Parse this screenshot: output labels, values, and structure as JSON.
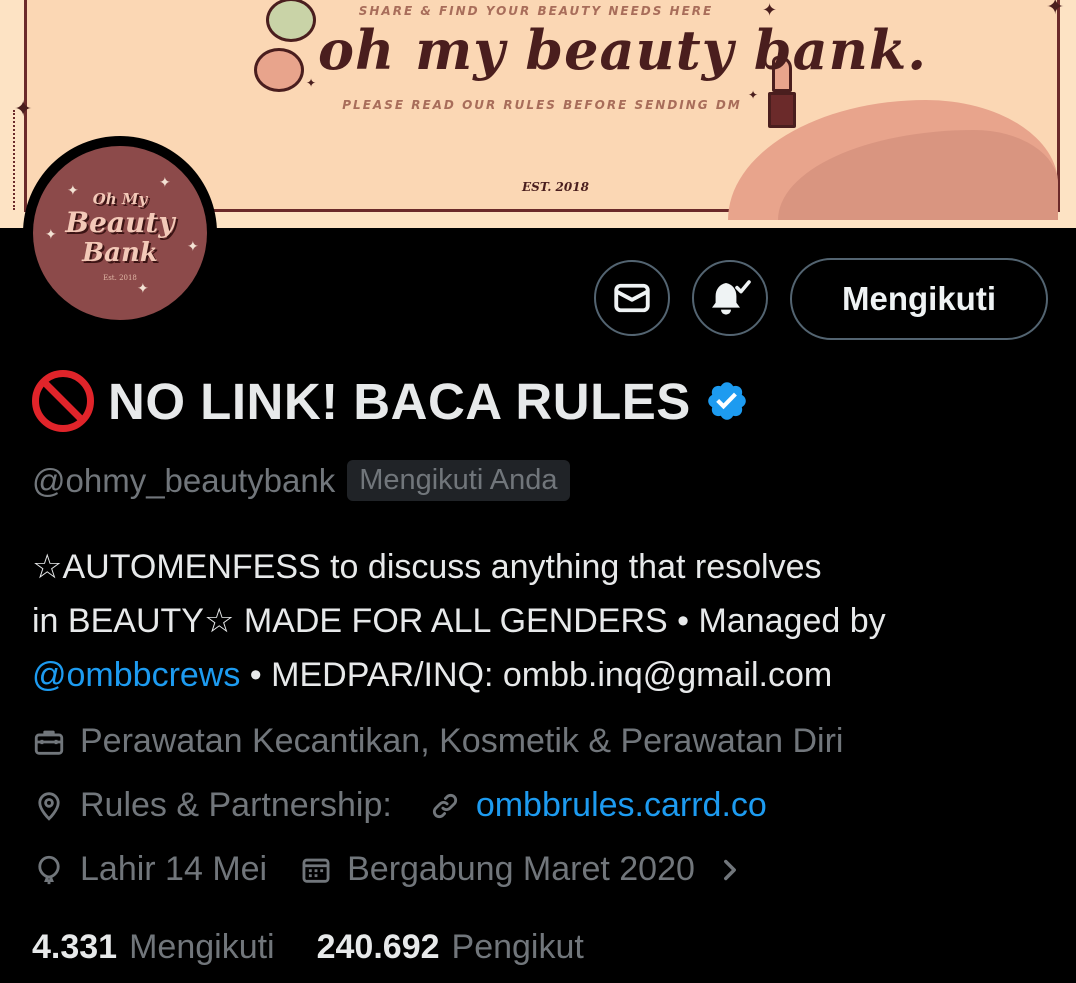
{
  "banner": {
    "tagline": "SHARE & FIND YOUR BEAUTY NEEDS HERE",
    "title": "oh my beauty bank.",
    "subtitle": "PLEASE READ OUR RULES BEFORE SENDING DM",
    "est": "EST. 2018",
    "colors": {
      "background": "#fbd7b4",
      "accent": "#4a1e1e",
      "wave": "#e8a48c"
    }
  },
  "avatar": {
    "line1": "Oh My",
    "line2": "Beauty",
    "line3": "Bank",
    "line4": "Est. 2018",
    "background": "#8c4a4a"
  },
  "actions": {
    "message_icon": "mail-icon",
    "notify_icon": "bell-check-icon",
    "follow_label": "Mengikuti"
  },
  "profile": {
    "name": "NO LINK! BACA RULES",
    "name_prefix_icon": "no-entry-icon",
    "verified_icon": "verified-badge-icon",
    "handle": "@ohmy_beautybank",
    "follows_you": "Mengikuti Anda"
  },
  "bio": {
    "line1": "☆AUTOMENFESS to discuss anything that resolves",
    "line2": "in BEAUTY☆ MADE FOR ALL GENDERS • Managed by",
    "mention": "@ombbcrews",
    "line3_rest": " • MEDPAR/INQ: ombb.inq@gmail.com"
  },
  "meta": {
    "category": "Perawatan Kecantikan, Kosmetik & Perawatan Diri",
    "location": "Rules & Partnership:",
    "link": "ombbrules.carrd.co",
    "birthday": "Lahir 14 Mei",
    "joined": "Bergabung Maret 2020",
    "icons": [
      "briefcase-icon",
      "location-pin-icon",
      "link-icon",
      "balloon-icon",
      "calendar-icon",
      "chevron-right-icon"
    ]
  },
  "stats": {
    "following_count": "4.331",
    "following_label": "Mengikuti",
    "followers_count": "240.692",
    "followers_label": "Pengikut"
  },
  "colors": {
    "link": "#1d9bf0",
    "muted": "#71767b",
    "text": "#e7e9ea",
    "border": "#536471",
    "no_entry": "#e0242a"
  }
}
